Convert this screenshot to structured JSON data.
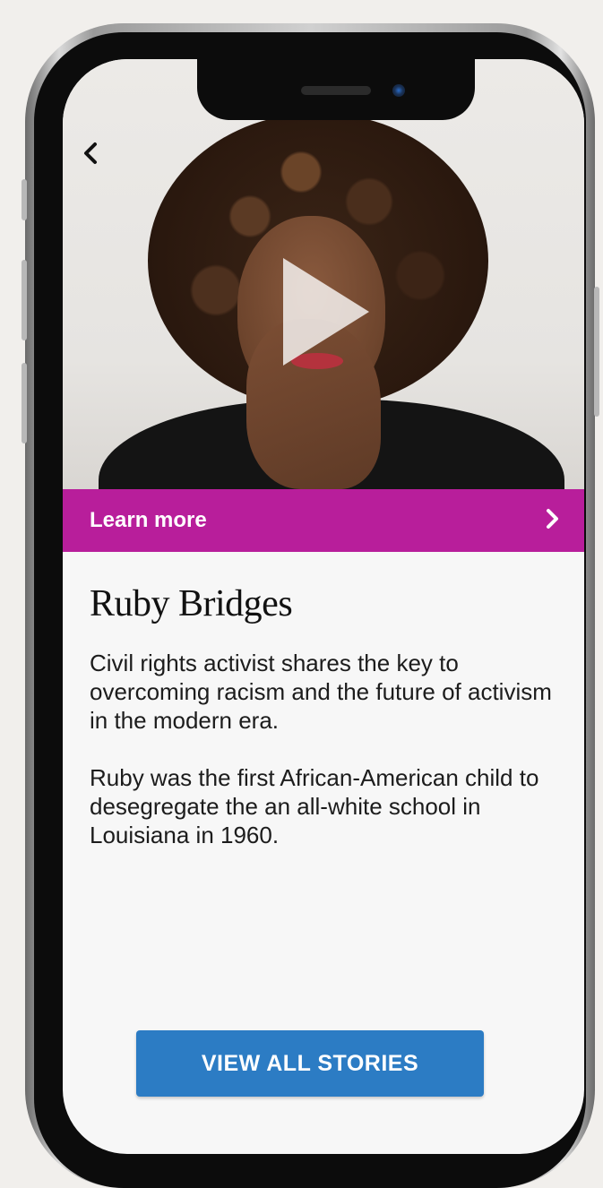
{
  "hero": {
    "back_icon": "chevron-left-icon",
    "play_icon": "play-icon"
  },
  "learn_more": {
    "label": "Learn more",
    "icon": "chevron-right-icon",
    "color": "#b81e9b"
  },
  "story": {
    "title": "Ruby Bridges",
    "paragraph1": "Civil rights activist shares the key to overcoming racism and the future of activism in the modern era.",
    "paragraph2": "Ruby was the first African-American child to desegregate the an all-white school in Louisiana in 1960."
  },
  "cta": {
    "label": "VIEW ALL STORIES",
    "color": "#2c7cc4"
  }
}
